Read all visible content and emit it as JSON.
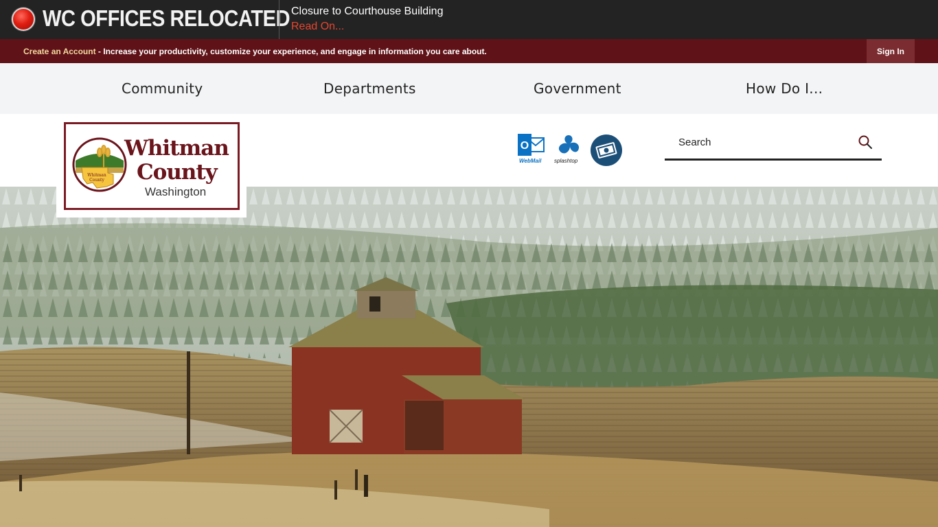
{
  "alert": {
    "title": "WC OFFICES RELOCATED",
    "headline": "Closure to Courthouse Building",
    "link": "Read On..."
  },
  "account_bar": {
    "create_link": "Create an Account",
    "description": " - Increase your productivity, customize your experience, and engage in information you care about.",
    "sign_in": "Sign In"
  },
  "nav": {
    "items": [
      {
        "label": "Community"
      },
      {
        "label": "Departments"
      },
      {
        "label": "Government"
      },
      {
        "label": "How Do I..."
      }
    ]
  },
  "logo": {
    "line1": "Whitman",
    "line2": "County",
    "line3": "Washington",
    "emblem_text": "Whitman County"
  },
  "quick_links": [
    {
      "icon": "outlook-webmail-icon",
      "label": "WebMail"
    },
    {
      "icon": "splashtop-icon",
      "label": "splashtop"
    },
    {
      "icon": "payment-icon",
      "label": ""
    }
  ],
  "search": {
    "placeholder": "Search",
    "value": ""
  },
  "colors": {
    "alert_bg": "#232323",
    "account_bar": "#5f1217",
    "brand": "#6a141b",
    "link_red": "#e8452f"
  }
}
